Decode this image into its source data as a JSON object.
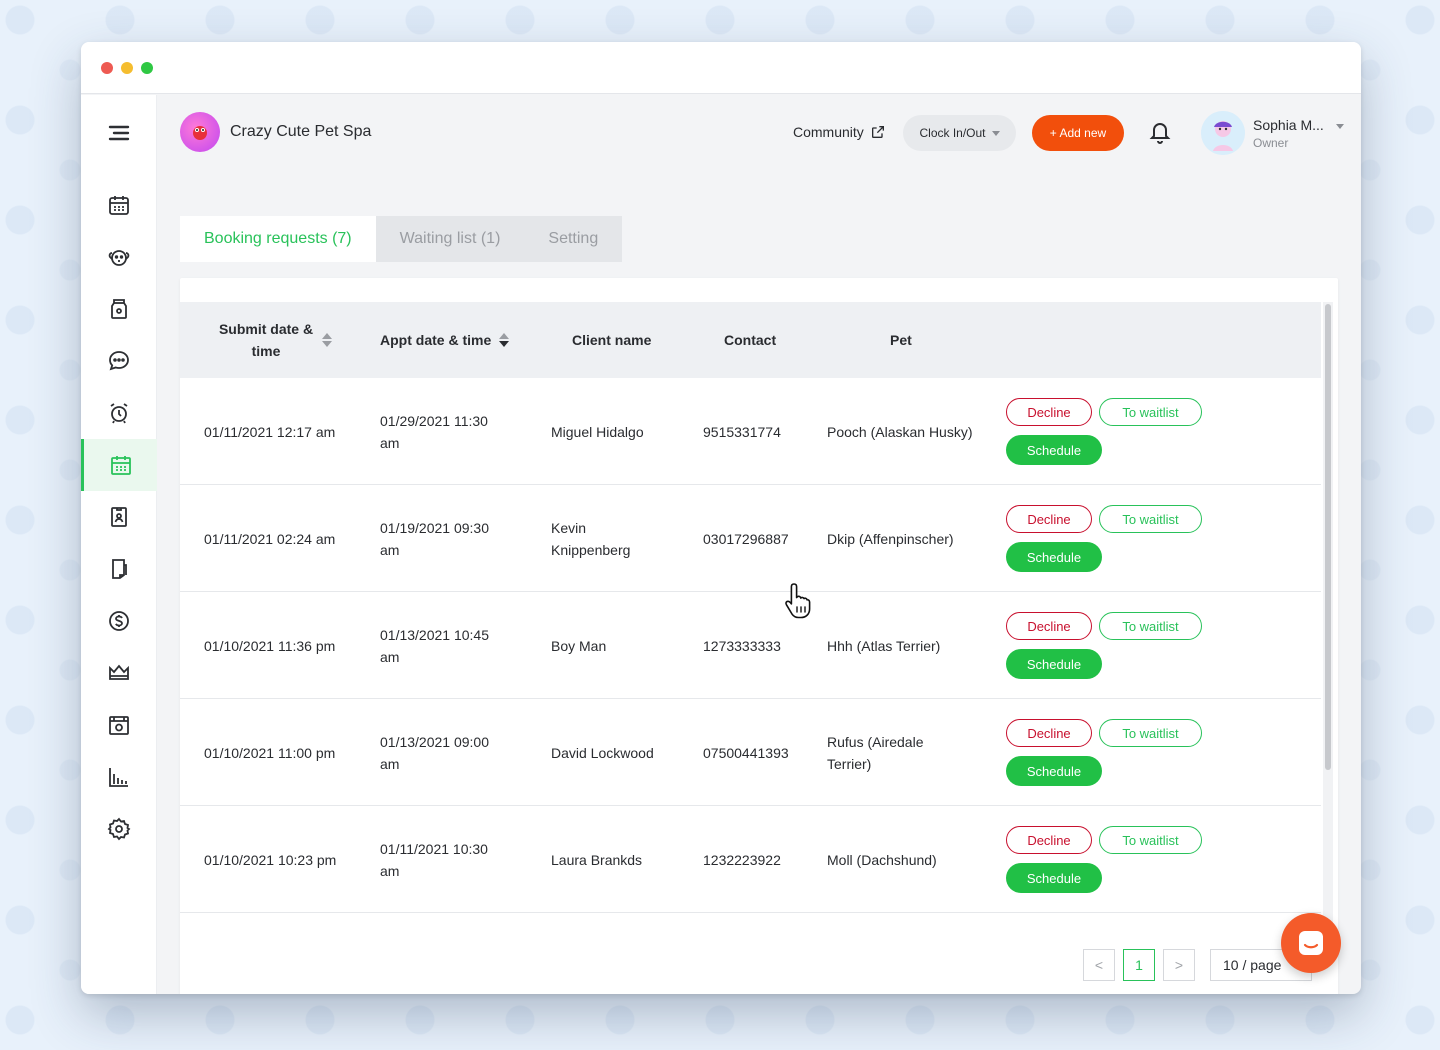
{
  "brand": {
    "name": "Crazy Cute Pet Spa"
  },
  "header": {
    "community_label": "Community",
    "clock_label": "Clock In/Out",
    "add_label": "+ Add new",
    "user_name": "Sophia M...",
    "user_role": "Owner"
  },
  "sidebar": {
    "items": [
      {
        "icon": "menu-icon"
      },
      {
        "icon": "calendar-icon"
      },
      {
        "icon": "dog-icon"
      },
      {
        "icon": "pet-food-icon"
      },
      {
        "icon": "chat-icon"
      },
      {
        "icon": "alarm-clock-icon"
      },
      {
        "icon": "booking-calendar-icon",
        "active": true
      },
      {
        "icon": "staff-badge-icon"
      },
      {
        "icon": "invoice-icon"
      },
      {
        "icon": "dollar-icon"
      },
      {
        "icon": "crown-icon"
      },
      {
        "icon": "kennel-icon"
      },
      {
        "icon": "bar-chart-icon"
      },
      {
        "icon": "gear-icon"
      }
    ]
  },
  "tabs": [
    {
      "label": "Booking requests (7)",
      "active": true
    },
    {
      "label": "Waiting list (1)"
    },
    {
      "label": "Setting"
    }
  ],
  "table": {
    "columns": {
      "submit": "Submit date & time",
      "appt": "Appt date & time",
      "client": "Client name",
      "contact": "Contact",
      "pet": "Pet"
    },
    "actions": {
      "decline": "Decline",
      "waitlist": "To waitlist",
      "schedule": "Schedule"
    },
    "rows": [
      {
        "submit": "01/11/2021 12:17 am",
        "appt": "01/29/2021 11:30 am",
        "client": "Miguel Hidalgo",
        "contact": "9515331774",
        "pet": "Pooch (Alaskan Husky)"
      },
      {
        "submit": "01/11/2021 02:24 am",
        "appt": "01/19/2021 09:30 am",
        "client": "Kevin Knippenberg",
        "contact": "03017296887",
        "pet": "Dkip (Affenpinscher)"
      },
      {
        "submit": "01/10/2021 11:36 pm",
        "appt": "01/13/2021 10:45 am",
        "client": "Boy Man",
        "contact": "1273333333",
        "pet": "Hhh (Atlas Terrier)"
      },
      {
        "submit": "01/10/2021 11:00 pm",
        "appt": "01/13/2021 09:00 am",
        "client": "David Lockwood",
        "contact": "07500441393",
        "pet": "Rufus (Airedale Terrier)"
      },
      {
        "submit": "01/10/2021 10:23 pm",
        "appt": "01/11/2021 10:30 am",
        "client": "Laura Brankds",
        "contact": "1232223922",
        "pet": "Moll (Dachshund)"
      }
    ]
  },
  "pagination": {
    "prev": "<",
    "current": "1",
    "next": ">",
    "page_size": "10 / page"
  },
  "colors": {
    "accent_green": "#29c25a",
    "add_orange": "#f24f0c",
    "decline_red": "#c8102e"
  }
}
